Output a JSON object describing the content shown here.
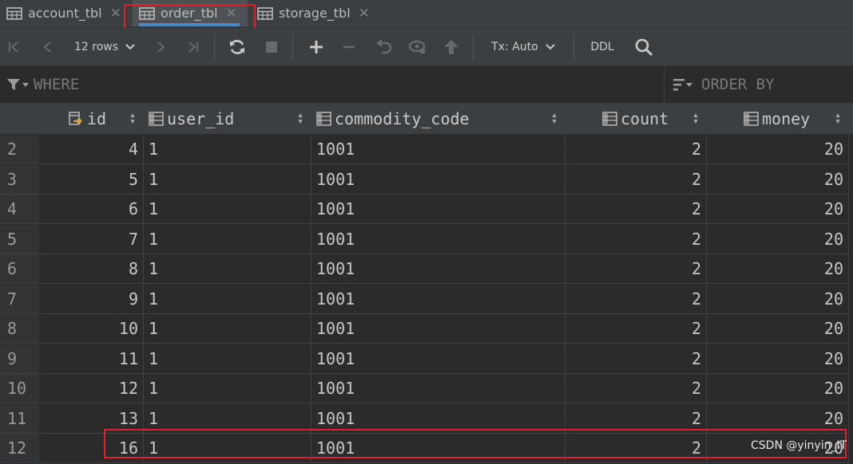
{
  "tabs": [
    {
      "label": "account_tbl",
      "active": false
    },
    {
      "label": "order_tbl",
      "active": true
    },
    {
      "label": "storage_tbl",
      "active": false
    }
  ],
  "toolbar": {
    "rows_label": "12 rows",
    "tx_label": "Tx: Auto",
    "ddl_label": "DDL"
  },
  "filter": {
    "where_label": "WHERE",
    "order_by_label": "ORDER BY"
  },
  "columns": [
    {
      "label": "id",
      "key": true
    },
    {
      "label": "user_id"
    },
    {
      "label": "commodity_code"
    },
    {
      "label": "count"
    },
    {
      "label": "money"
    }
  ],
  "rows": [
    {
      "n": "2",
      "id": "4",
      "user_id": "1",
      "commodity_code": "1001",
      "count": "2",
      "money": "20"
    },
    {
      "n": "3",
      "id": "5",
      "user_id": "1",
      "commodity_code": "1001",
      "count": "2",
      "money": "20"
    },
    {
      "n": "4",
      "id": "6",
      "user_id": "1",
      "commodity_code": "1001",
      "count": "2",
      "money": "20"
    },
    {
      "n": "5",
      "id": "7",
      "user_id": "1",
      "commodity_code": "1001",
      "count": "2",
      "money": "20"
    },
    {
      "n": "6",
      "id": "8",
      "user_id": "1",
      "commodity_code": "1001",
      "count": "2",
      "money": "20"
    },
    {
      "n": "7",
      "id": "9",
      "user_id": "1",
      "commodity_code": "1001",
      "count": "2",
      "money": "20"
    },
    {
      "n": "8",
      "id": "10",
      "user_id": "1",
      "commodity_code": "1001",
      "count": "2",
      "money": "20"
    },
    {
      "n": "9",
      "id": "11",
      "user_id": "1",
      "commodity_code": "1001",
      "count": "2",
      "money": "20"
    },
    {
      "n": "10",
      "id": "12",
      "user_id": "1",
      "commodity_code": "1001",
      "count": "2",
      "money": "20"
    },
    {
      "n": "11",
      "id": "13",
      "user_id": "1",
      "commodity_code": "1001",
      "count": "2",
      "money": "20"
    },
    {
      "n": "12",
      "id": "16",
      "user_id": "1",
      "commodity_code": "1001",
      "count": "2",
      "money": "20"
    }
  ],
  "watermark": "CSDN @yinyin_IT",
  "colors": {
    "highlight": "#e0202c",
    "accent": "#4a88c7"
  }
}
